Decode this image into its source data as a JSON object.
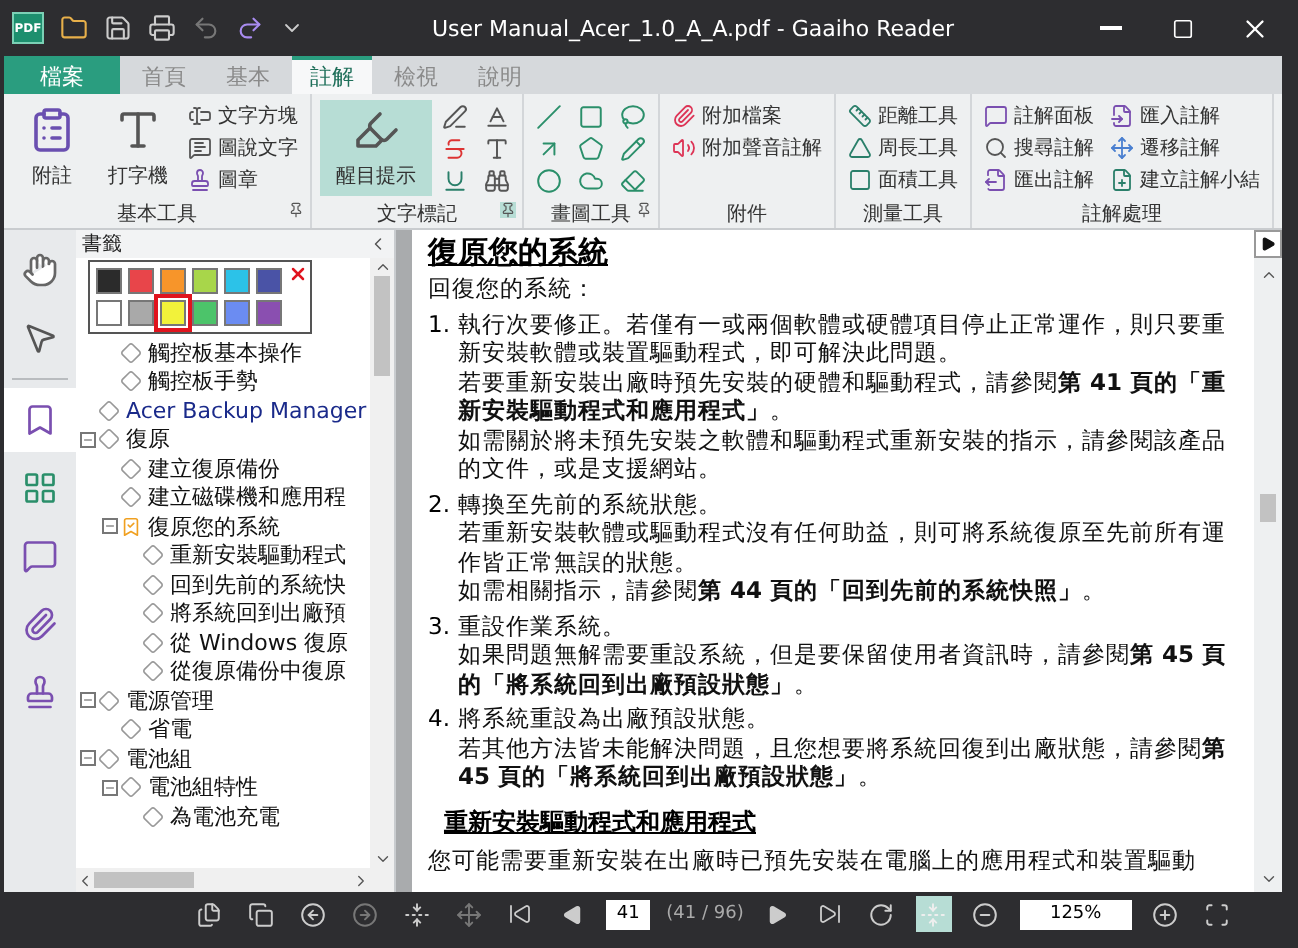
{
  "window": {
    "logo": "PDF",
    "title": "User Manual_Acer_1.0_A_A.pdf - Gaaiho Reader"
  },
  "ribbon_tabs": [
    {
      "label": "檔案",
      "kind": "file"
    },
    {
      "label": "首頁",
      "kind": "tab",
      "selected": false
    },
    {
      "label": "基本",
      "kind": "tab",
      "selected": false
    },
    {
      "label": "註解",
      "kind": "tab",
      "selected": true
    },
    {
      "label": "檢視",
      "kind": "tab",
      "selected": false
    },
    {
      "label": "說明",
      "kind": "tab",
      "selected": false
    }
  ],
  "ribbon_groups": [
    {
      "label": "基本工具",
      "items": [
        {
          "kind": "large",
          "label": "附註",
          "selected": false
        },
        {
          "kind": "large",
          "label": "打字機",
          "selected": false
        },
        {
          "kind": "small",
          "label": "文字方塊",
          "selected": false
        },
        {
          "kind": "small",
          "label": "圖說文字",
          "selected": false
        },
        {
          "kind": "small",
          "label": "圖章",
          "selected": false
        }
      ]
    },
    {
      "label": "文字標記",
      "items": [
        {
          "kind": "large",
          "label": "醒目提示",
          "selected": true
        },
        {
          "kind": "icon",
          "selected": false
        },
        {
          "kind": "icon",
          "selected": false
        },
        {
          "kind": "icon",
          "selected": false
        },
        {
          "kind": "icon",
          "selected": false
        },
        {
          "kind": "icon",
          "selected": false
        },
        {
          "kind": "icon",
          "selected": false
        }
      ]
    },
    {
      "label": "畫圖工具",
      "items": [
        {
          "kind": "icon",
          "selected": false
        },
        {
          "kind": "icon",
          "selected": false
        },
        {
          "kind": "icon",
          "selected": false
        },
        {
          "kind": "icon",
          "selected": false
        },
        {
          "kind": "icon",
          "selected": false
        },
        {
          "kind": "icon",
          "selected": false
        },
        {
          "kind": "icon",
          "selected": false
        },
        {
          "kind": "icon",
          "selected": false
        },
        {
          "kind": "icon",
          "selected": false
        }
      ]
    },
    {
      "label": "附件",
      "items": [
        {
          "kind": "small",
          "label": "附加檔案",
          "selected": false
        },
        {
          "kind": "small",
          "label": "附加聲音註解",
          "selected": false
        }
      ]
    },
    {
      "label": "測量工具",
      "items": [
        {
          "kind": "small",
          "label": "距離工具",
          "selected": false
        },
        {
          "kind": "small",
          "label": "周長工具",
          "selected": false
        },
        {
          "kind": "small",
          "label": "面積工具",
          "selected": false
        }
      ]
    },
    {
      "label": "註解處理",
      "items": [
        {
          "kind": "small",
          "label": "註解面板",
          "selected": false
        },
        {
          "kind": "small",
          "label": "搜尋註解",
          "selected": false
        },
        {
          "kind": "small",
          "label": "匯出註解",
          "selected": false
        },
        {
          "kind": "small",
          "label": "匯入註解",
          "selected": false
        },
        {
          "kind": "small",
          "label": "遷移註解",
          "selected": false
        },
        {
          "kind": "small",
          "label": "建立註解小結",
          "selected": false
        }
      ]
    }
  ],
  "tool_rail": [
    {
      "selected": false
    },
    {
      "selected": false
    },
    {
      "selected": true
    },
    {
      "selected": false
    },
    {
      "selected": false
    },
    {
      "selected": false
    },
    {
      "selected": false
    }
  ],
  "bookmarks": {
    "title": "書籤",
    "tree": [
      {
        "children": [
          {
            "label": "觸控板基本操作"
          },
          {
            "label": "觸控板手勢"
          }
        ]
      },
      {
        "label": "Acer Backup Manager"
      },
      {
        "label": "復原",
        "expanded": true,
        "children": [
          {
            "label": "建立復原備份"
          },
          {
            "label": "建立磁碟機和應用程"
          },
          {
            "label": "復原您的系統",
            "expanded": true,
            "selected": true,
            "children": [
              {
                "label": "重新安裝驅動程式"
              },
              {
                "label": "回到先前的系統快"
              },
              {
                "label": "將系統回到出廠預"
              },
              {
                "label": "從 Windows 復原"
              },
              {
                "label": "從復原備份中復原"
              }
            ]
          }
        ]
      },
      {
        "label": "電源管理",
        "expanded": true,
        "children": [
          {
            "label": "省電"
          }
        ]
      },
      {
        "label": "電池組",
        "expanded": true,
        "children": [
          {
            "label": "電池組特性",
            "expanded": true,
            "children": [
              {
                "label": "為電池充電"
              }
            ]
          }
        ]
      }
    ]
  },
  "color_picker": {
    "swatches": [
      {
        "color": "#2b2b2b",
        "selected": false
      },
      {
        "color": "#e8454a",
        "selected": false
      },
      {
        "color": "#f7952a",
        "selected": false
      },
      {
        "color": "#a8d64a",
        "selected": false
      },
      {
        "color": "#2cc2e8",
        "selected": false
      },
      {
        "color": "#4a53a6",
        "selected": false
      },
      {
        "color": "#ffffff",
        "selected": false
      },
      {
        "color": "#a9a9a9",
        "selected": false
      },
      {
        "color": "#f2f23a",
        "selected": true
      },
      {
        "color": "#4cc46a",
        "selected": false
      },
      {
        "color": "#6b8cf2",
        "selected": false
      },
      {
        "color": "#8a4fb0",
        "selected": false
      }
    ]
  },
  "document": {
    "heading": "復原您的系統",
    "intro": "回復您的系統：",
    "steps": [
      {
        "number": "1.",
        "paragraphs": [
          "執行次要修正。若僅有一或兩個軟體或硬體項目停止正常運作，則只要重新安裝軟體或裝置驅動程式，即可解決此問題。",
          "若要重新安裝出廠時預先安裝的硬體和驅動程式，請參閱**第 41 頁的「重新安裝驅動程式和應用程式」**。",
          "如需關於將未預先安裝之軟體和驅動程式重新安裝的指示，請參閱該產品的文件，或是支援網站。"
        ]
      },
      {
        "number": "2.",
        "paragraphs": [
          "轉換至先前的系統狀態。",
          "若重新安裝軟體或驅動程式沒有任何助益，則可將系統復原至先前所有運作皆正常無誤的狀態。",
          "如需相關指示，請參閱**第 44 頁的「回到先前的系統快照」**。"
        ]
      },
      {
        "number": "3.",
        "paragraphs": [
          "重設作業系統。",
          "如果問題無解需要重設系統，但是要保留使用者資訊時，請參閱**第 45 頁的「將系統回到出廠預設狀態」**。"
        ]
      },
      {
        "number": "4.",
        "paragraphs": [
          "將系統重設為出廠預設狀態。",
          "若其他方法皆未能解決問題，且您想要將系統回復到出廠狀態，請參閱**第 45 頁的「將系統回到出廠預設狀態」**。"
        ]
      }
    ],
    "subheading": "重新安裝驅動程式和應用程式",
    "closing": "您可能需要重新安裝在出廠時已預先安裝在電腦上的應用程式和裝置驅動"
  },
  "bottom_bar": {
    "page": "41",
    "page_count": "(41 / 96)",
    "zoom": "125%",
    "fit_modes": [
      {
        "selected": false
      },
      {
        "selected": true
      }
    ]
  }
}
